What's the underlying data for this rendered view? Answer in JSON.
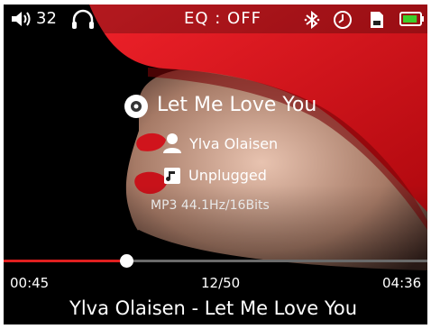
{
  "status": {
    "volume": "32",
    "eq": "EQ : OFF",
    "battery_level": 0.8
  },
  "track": {
    "title": "Let Me Love You",
    "artist": "Ylva Olaisen",
    "album": "Unplugged",
    "format": "MP3 44.1Hz/16Bits"
  },
  "playback": {
    "elapsed": "00:45",
    "total": "04:36",
    "index": "12/50",
    "progress": 0.29,
    "now_playing": "Ylva Olaisen - Let Me Love You"
  },
  "colors": {
    "accent": "#e02020",
    "battery": "#3dcf2a",
    "hat": "#d8141a"
  },
  "icons": [
    "speaker-icon",
    "headphones-icon",
    "bluetooth-icon",
    "clock-icon",
    "sd-card-icon",
    "battery-icon",
    "disc-icon",
    "person-icon",
    "music-note-icon"
  ]
}
